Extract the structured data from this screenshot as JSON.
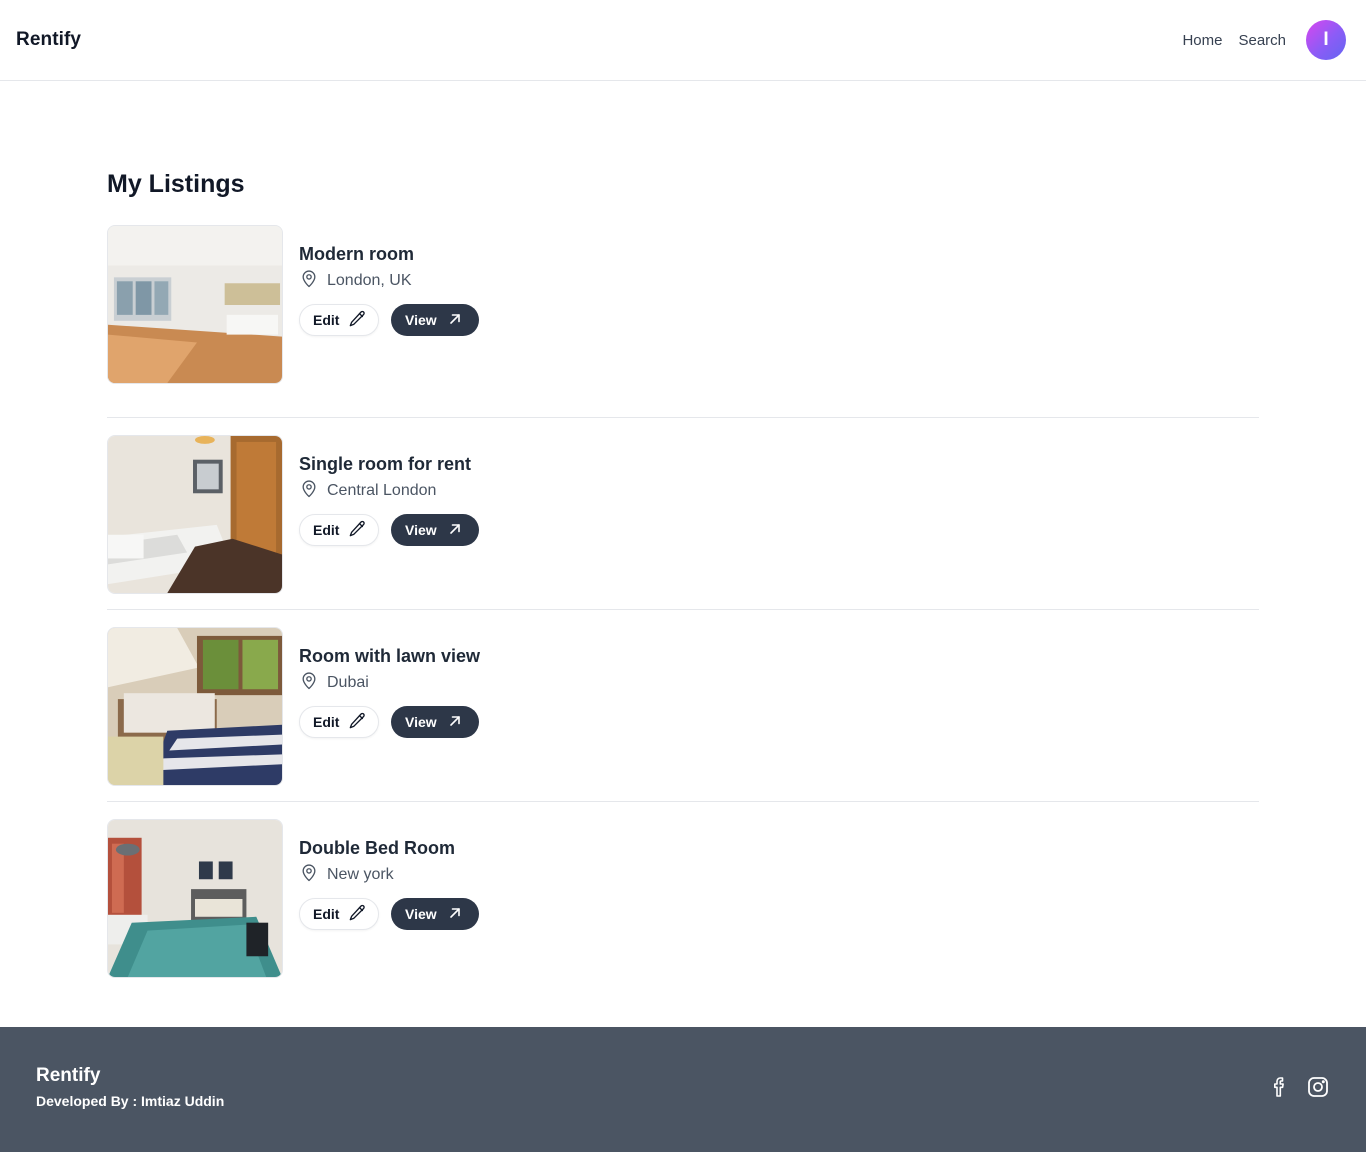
{
  "header": {
    "brand": "Rentify",
    "nav": [
      {
        "label": "Home"
      },
      {
        "label": "Search"
      }
    ],
    "avatar_initial": "I"
  },
  "main": {
    "title": "My Listings",
    "listings": [
      {
        "title": "Modern room",
        "location": "London, UK",
        "edit_label": "Edit",
        "view_label": "View",
        "image": "empty living room with wooden floor and large windows"
      },
      {
        "title": "Single room for rent",
        "location": "Central London",
        "edit_label": "Edit",
        "view_label": "View",
        "image": "small bedroom with single bed and wooden wardrobe"
      },
      {
        "title": "Room with lawn view",
        "location": "Dubai",
        "edit_label": "Edit",
        "view_label": "View",
        "image": "attic bedroom with striped rug and window to greenery"
      },
      {
        "title": "Double Bed Room",
        "location": "New york",
        "edit_label": "Edit",
        "view_label": "View",
        "image": "bedroom with teal bedspread and headboard"
      }
    ]
  },
  "footer": {
    "brand": "Rentify",
    "credit": "Developed By : Imtiaz Uddin",
    "social": [
      "facebook-icon",
      "instagram-icon"
    ]
  },
  "colors": {
    "footer_bg": "#4b5563",
    "view_button_bg": "#2d3748",
    "avatar_gradient_start": "#d946ef",
    "avatar_gradient_end": "#6366f1"
  }
}
